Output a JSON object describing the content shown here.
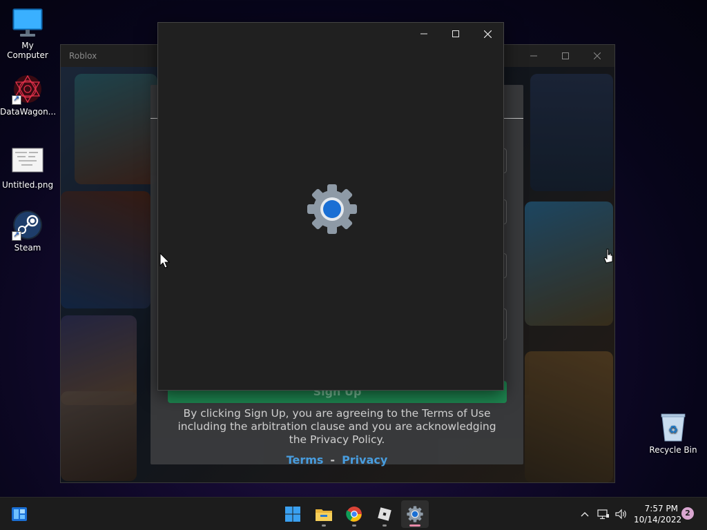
{
  "desktop": {
    "icons": [
      {
        "label": "My Computer"
      },
      {
        "label": "DataWagon..."
      },
      {
        "label": "Untitled.png"
      },
      {
        "label": "Steam"
      }
    ],
    "recycle_bin": "Recycle Bin"
  },
  "roblox_window": {
    "title": "Roblox",
    "signup_button": "Sign Up",
    "legal_text": "By clicking Sign Up, you are agreeing to the Terms of Use including the arbitration clause and you are acknowledging the Privacy Policy.",
    "terms_link": "Terms",
    "separator": "-",
    "privacy_link": "Privacy"
  },
  "loading_dialog": {
    "icon": "gear-icon"
  },
  "taskbar": {
    "apps": [
      "windows-start",
      "file-explorer",
      "chrome",
      "roblox",
      "settings"
    ],
    "time": "7:57 PM",
    "date": "10/14/2022",
    "notification_count": "2"
  },
  "colors": {
    "signup_green": "#1f8c54",
    "link_blue": "#4aa3e8",
    "gear_blue": "#1a6fd4"
  }
}
